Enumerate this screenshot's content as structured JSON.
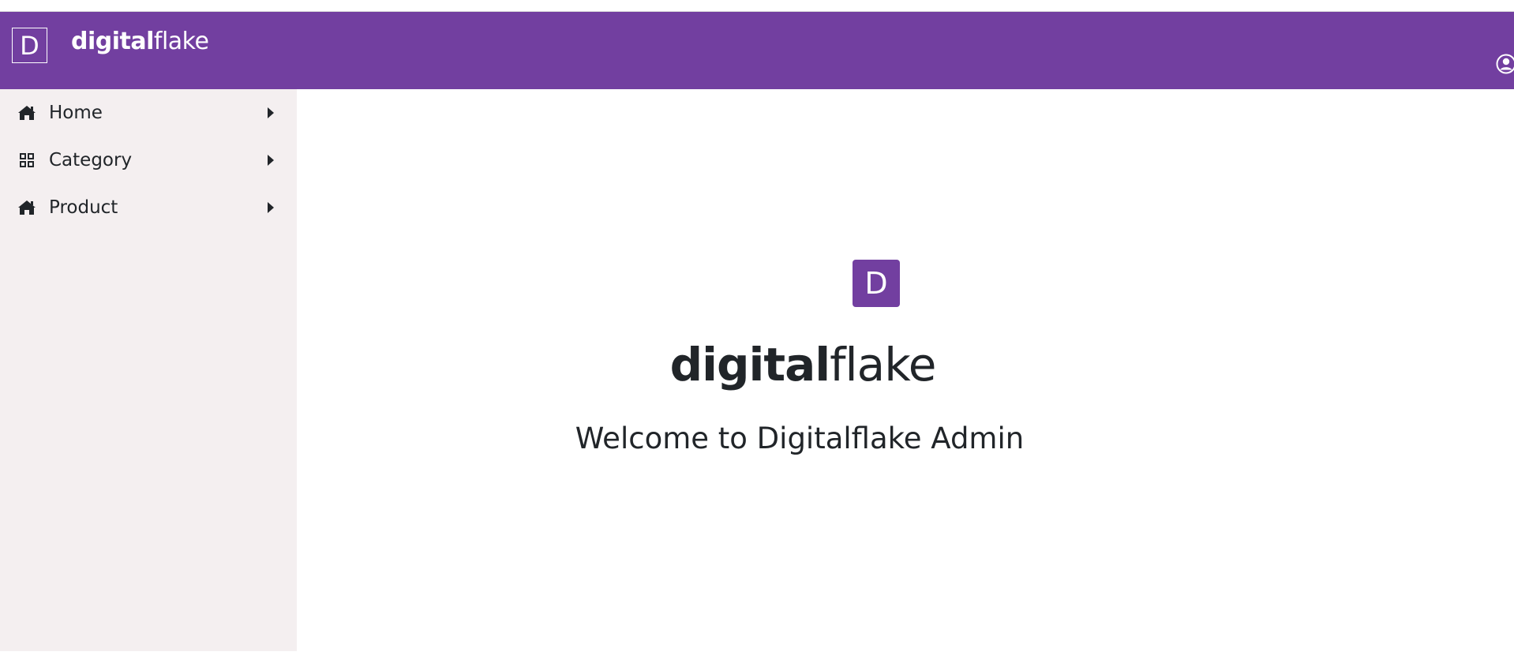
{
  "navbar": {
    "logo_letter": "D",
    "brand_bold": "digital",
    "brand_light": "flake",
    "user_icon": "user-circle-icon"
  },
  "sidebar": {
    "items": [
      {
        "label": "Home",
        "icon": "home-icon"
      },
      {
        "label": "Category",
        "icon": "grid-icon"
      },
      {
        "label": "Product",
        "icon": "home-icon"
      }
    ]
  },
  "main": {
    "logo_letter": "D",
    "brand_bold": "digital",
    "brand_light": "flake",
    "welcome_text": "Welcome to Digitalflake Admin"
  },
  "colors": {
    "brand": "#723fa0",
    "sidebar_bg": "#f4eff0",
    "text": "#212529"
  }
}
